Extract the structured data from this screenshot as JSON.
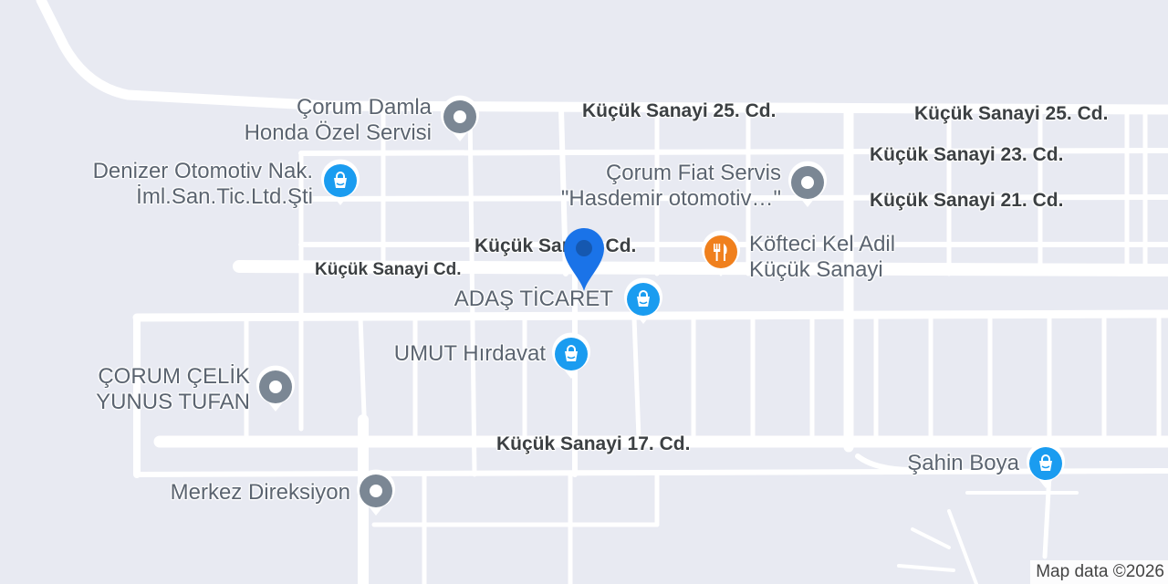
{
  "map": {
    "colors": {
      "background": "#e8eaf2",
      "road": "#ffffff",
      "gray_pin": "#7b8794",
      "blue_pin": "#1a9cf0",
      "orange_pin": "#f0801d",
      "marker": "#1a73e8"
    },
    "road_labels": [
      {
        "text": "Küçük Sanayi 25. Cd."
      },
      {
        "text": "Küçük Sanayi 25. Cd."
      },
      {
        "text": "Küçük Sanayi 23. Cd."
      },
      {
        "text": "Küçük Sanayi 21. Cd."
      },
      {
        "text": "Küçük Sanayi Cd."
      },
      {
        "text": "Küçük Sanayi Cd."
      },
      {
        "text": "Küçük Sanayi 17. Cd."
      }
    ],
    "places": [
      {
        "lines": [
          "Çorum Damla",
          "Honda Özel Servisi"
        ],
        "category": "service",
        "icon": "circle-icon"
      },
      {
        "lines": [
          "Denizer Otomotiv Nak.",
          "İml.San.Tic.Ltd.Şti"
        ],
        "category": "shopping",
        "icon": "shopping-bag-icon"
      },
      {
        "lines": [
          "Çorum Fiat Servis",
          "\"Hasdemir otomotiv…\""
        ],
        "category": "service",
        "icon": "circle-icon"
      },
      {
        "lines": [
          "Köfteci Kel Adil",
          "Küçük Sanayi"
        ],
        "category": "restaurant",
        "icon": "fork-knife-icon"
      },
      {
        "lines": [
          "ADAŞ TİCARET"
        ],
        "category": "shopping",
        "icon": "shopping-bag-icon"
      },
      {
        "lines": [
          "UMUT Hırdavat"
        ],
        "category": "shopping",
        "icon": "shopping-bag-icon"
      },
      {
        "lines": [
          "ÇORUM ÇELİK",
          "YUNUS TUFAN"
        ],
        "category": "service",
        "icon": "circle-icon"
      },
      {
        "lines": [
          "Şahin Boya"
        ],
        "category": "shopping",
        "icon": "shopping-bag-icon"
      },
      {
        "lines": [
          "Merkez Direksiyon"
        ],
        "category": "service",
        "icon": "circle-icon"
      }
    ],
    "attribution": "Map data ©2026"
  }
}
